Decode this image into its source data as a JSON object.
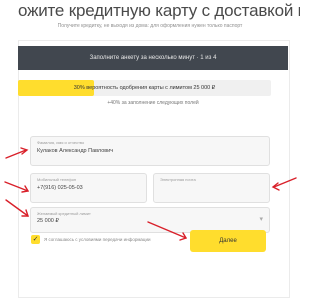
{
  "page": {
    "headline": "ожите кредитную карту с доставкой на",
    "subtitle": "Получите кредитку, не выходя из дома: для оформления нужен только паспорт"
  },
  "banner": {
    "text": "Заполните анкету за несколько минут · 1 из 4"
  },
  "progress": {
    "value": 0.3,
    "text": "30% вероятность одобрения карты с лимитом 25 000 ₽"
  },
  "note": {
    "text": "+40% за заполнение следующих полей"
  },
  "form": {
    "name": {
      "label": "Фамилия, имя и отчество",
      "value": "Кулаков Александр Павлович"
    },
    "phone": {
      "label": "Мобильный телефон",
      "value": "+7(916) 025-05-03"
    },
    "email": {
      "label": "Электронная почта",
      "value": ""
    },
    "limit": {
      "label": "Желаемый кредитный лимит",
      "value": "25 000 ₽"
    },
    "consent_text": "Я соглашаюсь с условиями передачи информации",
    "submit_label": "Далее"
  },
  "colors": {
    "accent": "#ffdd2d",
    "banner": "#41474f",
    "arrow": "#d9202a"
  }
}
